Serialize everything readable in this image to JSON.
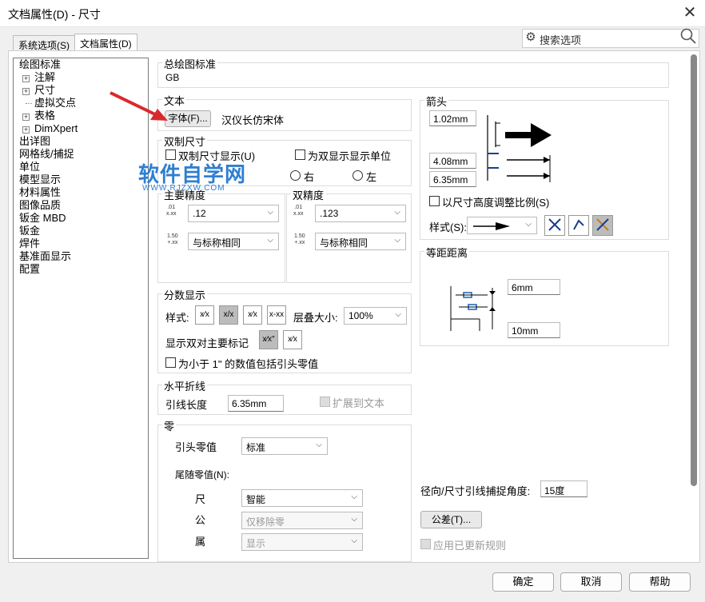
{
  "window": {
    "title": "文档属性(D) - 尺寸",
    "close_icon": "✕"
  },
  "tabs": [
    {
      "label": "系统选项(S)"
    },
    {
      "label": "文档属性(D)"
    }
  ],
  "search": {
    "placeholder": "搜索选项",
    "gear": "⚙",
    "mag": "🔍︎"
  },
  "tree": {
    "items": [
      {
        "label": "绘图标准"
      },
      {
        "label": "注解"
      },
      {
        "label": "尺寸"
      },
      {
        "label": "虚拟交点"
      },
      {
        "label": "表格"
      },
      {
        "label": "DimXpert"
      },
      {
        "label": "出详图"
      },
      {
        "label": "网格线/捕捉"
      },
      {
        "label": "单位"
      },
      {
        "label": "模型显示"
      },
      {
        "label": "材料属性"
      },
      {
        "label": "图像品质"
      },
      {
        "label": "钣金 MBD"
      },
      {
        "label": "钣金"
      },
      {
        "label": "焊件"
      },
      {
        "label": "基准面显示"
      },
      {
        "label": "配置"
      }
    ]
  },
  "overall_standard": {
    "title": "总绘图标准",
    "value": "GB"
  },
  "text": {
    "title": "文本",
    "font_button": "字体(F)...",
    "font_name": "汉仪长仿宋体"
  },
  "dual": {
    "title": "双制尺寸",
    "show_dual": "双制尺寸显示(U)",
    "show_units": "为双显示显示单位",
    "right": "右",
    "left": "左"
  },
  "primary_precision": {
    "title": "主要精度",
    "value1": ".12",
    "value2": "与标称相同",
    "icon1a": ".01",
    "icon1b": "x.xx",
    "icon2a": "1.50",
    "icon2b": "+.xx"
  },
  "dual_precision": {
    "title": "双精度",
    "value1": ".123",
    "value2": "与标称相同"
  },
  "fraction": {
    "title": "分数显示",
    "style_label": "样式:",
    "stack_label": "层叠大小:",
    "stack_value": "100%",
    "show_dual_marks": "显示双对主要标记",
    "include_zero": "为小于 1\" 的数值包括引头零值",
    "btn1": "x⁄x",
    "btn2": "x/x",
    "btn3": "x⁄x",
    "btn4": "x-xx",
    "btn5": "x⁄x″",
    "btn6": "x⁄x"
  },
  "horizontal_jog": {
    "title": "水平折线",
    "leader_label": "引线长度",
    "leader_value": "6.35mm",
    "extend": "扩展到文本"
  },
  "zeros": {
    "title": "零",
    "leading_label": "引头零值",
    "leading_value": "标准",
    "trailing_label": "尾随零值(N):",
    "dim_label": "尺",
    "dim_value": "智能",
    "tol_label": "公",
    "tol_value": "仅移除零",
    "prop_label": "属",
    "prop_value": "显示"
  },
  "arrows": {
    "title": "箭头",
    "v1": "1.02mm",
    "v2": "4.08mm",
    "v3": "6.35mm",
    "scale_label": "以尺寸高度调整比例(S)",
    "style_label": "样式(S):"
  },
  "offset": {
    "title": "等距距离",
    "v1": "6mm",
    "v2": "10mm"
  },
  "radial": {
    "label": "径向/尺寸引线捕捉角度:",
    "value": "15度"
  },
  "tolerance_button": "公差(T)...",
  "apply_rules": "应用已更新规则",
  "footer": {
    "ok": "确定",
    "cancel": "取消",
    "help": "帮助"
  },
  "watermark": {
    "main": "软件自学网",
    "sub": "WWW.RJZXW.COM"
  },
  "accent_color": "#d9292f"
}
